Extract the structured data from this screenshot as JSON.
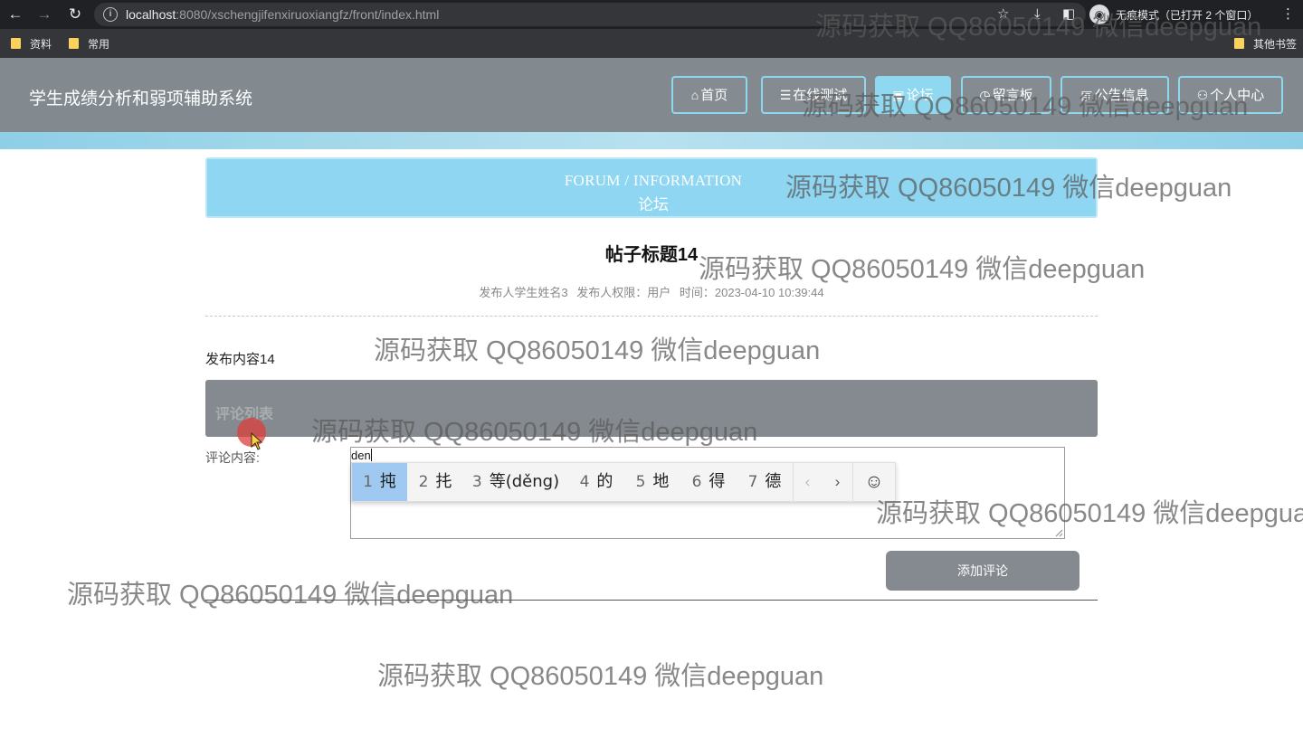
{
  "browser": {
    "url_host": "localhost",
    "url_path": ":8080/xschengjifenxiruoxiangfz/front/index.html",
    "incognito_label": "无痕模式（已打开 2 个窗口）",
    "bookmarks": [
      "资料",
      "常用"
    ],
    "other_bookmarks": "其他书签"
  },
  "site": {
    "title": "学生成绩分析和弱项辅助系统",
    "nav": [
      {
        "icon": "⌂",
        "label": "首页"
      },
      {
        "icon": "☰",
        "label": "在线测试"
      },
      {
        "icon": "▣",
        "label": "论坛"
      },
      {
        "icon": "◷",
        "label": "留言板"
      },
      {
        "icon": "▤",
        "label": "公告信息"
      },
      {
        "icon": "⚇",
        "label": "个人中心"
      }
    ]
  },
  "banner": {
    "title_en": "FORUM / INFORMATION",
    "title_zh": "论坛"
  },
  "post": {
    "title": "帖子标题14",
    "author": "发布人学生姓名3",
    "role": "发布人权限：用户",
    "time": "时间：2023-04-10 10:39:44",
    "content": "发布内容14"
  },
  "comments": {
    "header": "评论列表",
    "label": "评论内容:",
    "typed": "den",
    "submit": "添加评论"
  },
  "ime": {
    "candidates": [
      {
        "num": "1",
        "text": "扽"
      },
      {
        "num": "2",
        "text": "扥"
      },
      {
        "num": "3",
        "text": "等(děng)"
      },
      {
        "num": "4",
        "text": "的"
      },
      {
        "num": "5",
        "text": "地"
      },
      {
        "num": "6",
        "text": "得"
      },
      {
        "num": "7",
        "text": "德"
      }
    ],
    "prev": "‹",
    "next": "›",
    "emoji": "☺"
  },
  "watermark": "源码获取 QQ86050149 微信deepguan"
}
